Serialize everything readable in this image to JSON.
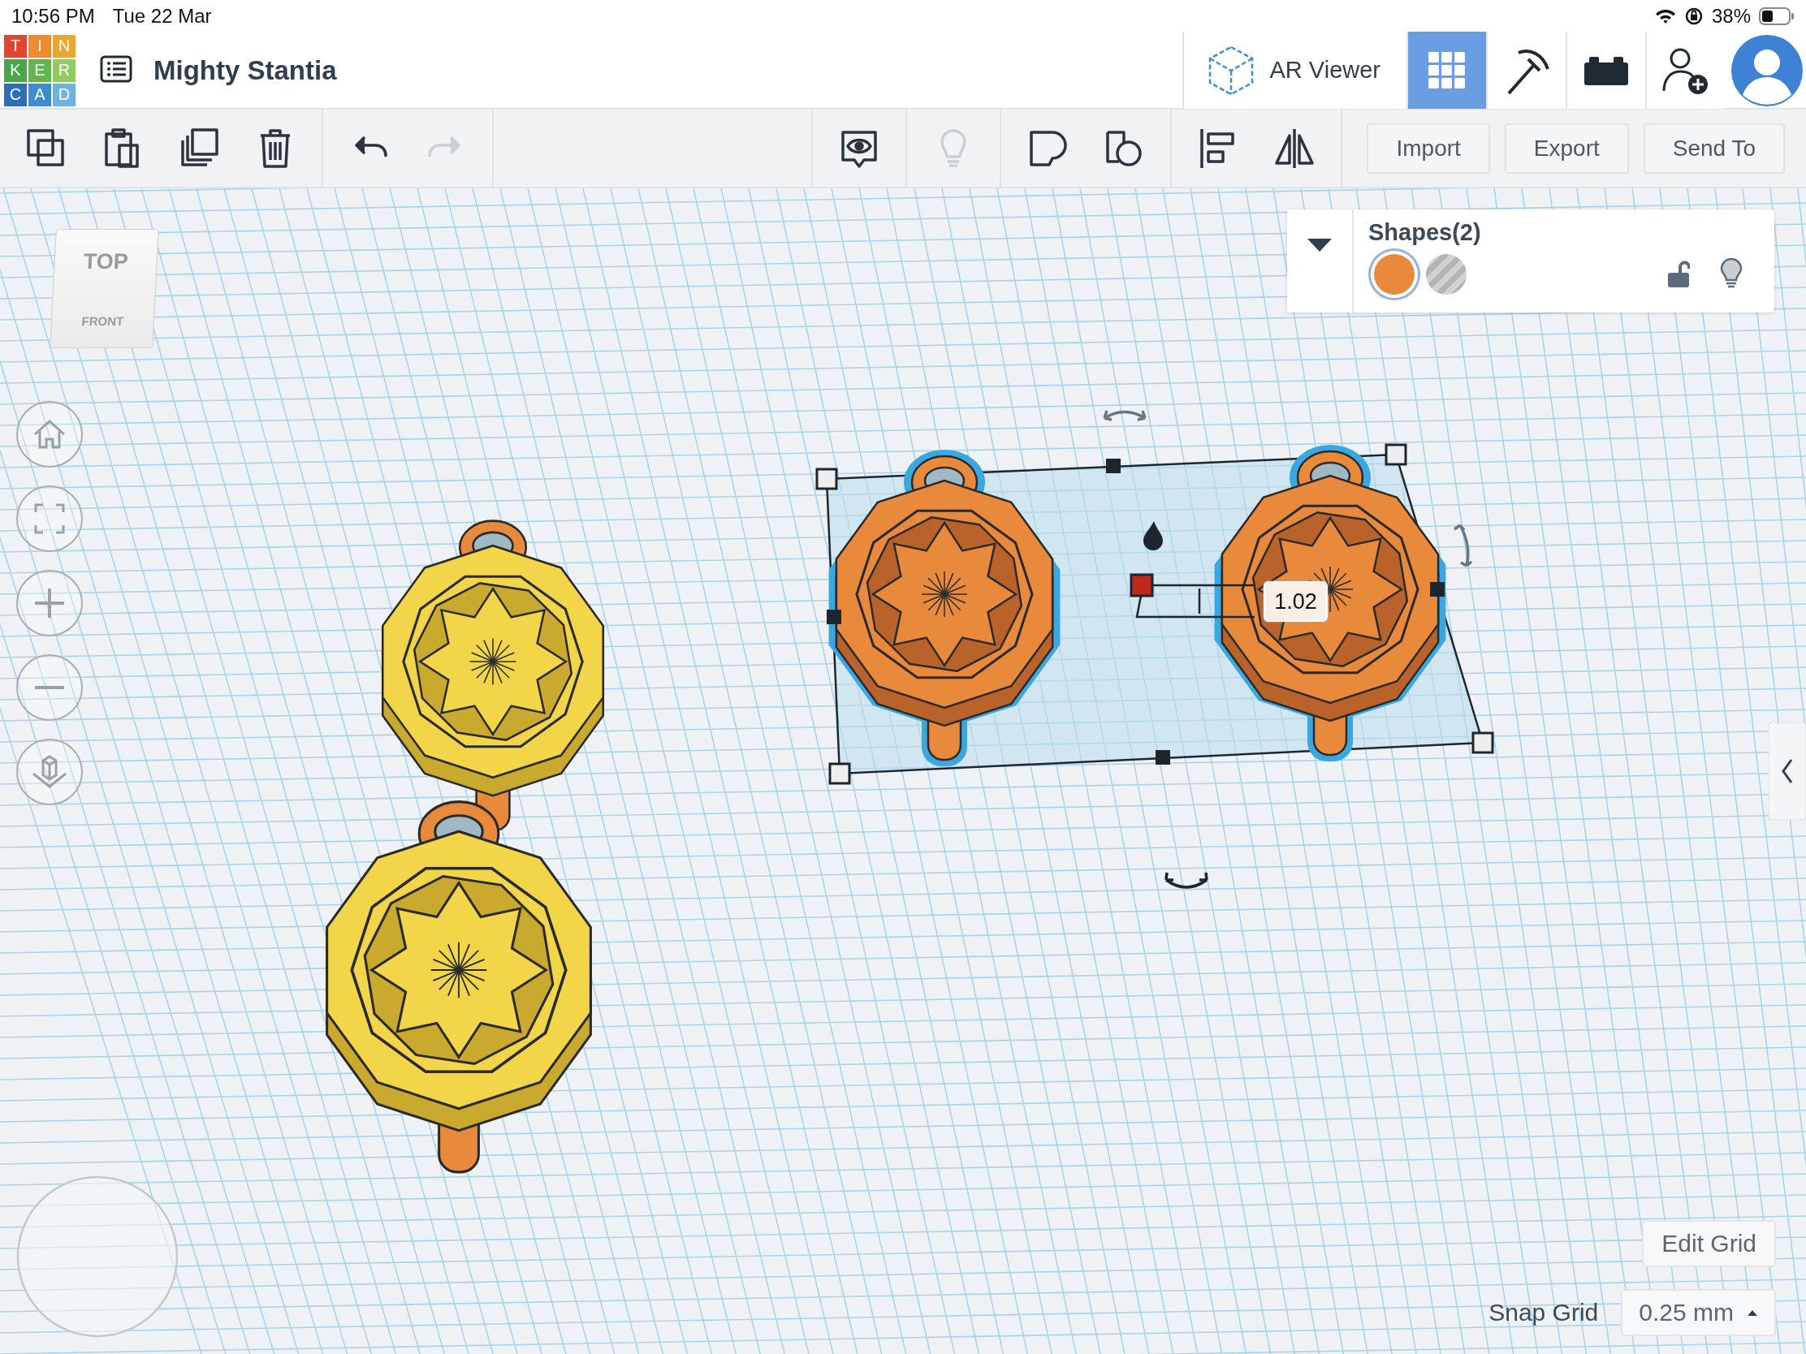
{
  "status_bar": {
    "time": "10:56 PM",
    "date": "Tue 22 Mar",
    "battery": "38%"
  },
  "app_bar": {
    "logo": [
      {
        "letter": "T",
        "color": "#e2452f"
      },
      {
        "letter": "I",
        "color": "#ef8a2d"
      },
      {
        "letter": "N",
        "color": "#eca52f"
      },
      {
        "letter": "K",
        "color": "#4aa54a"
      },
      {
        "letter": "E",
        "color": "#62b54f"
      },
      {
        "letter": "R",
        "color": "#8fcb61"
      },
      {
        "letter": "C",
        "color": "#2a6fb8"
      },
      {
        "letter": "A",
        "color": "#3c8ed0"
      },
      {
        "letter": "D",
        "color": "#6cb2e2"
      }
    ],
    "title": "Mighty Stantia",
    "ar_viewer": "AR Viewer",
    "view_tabs": [
      {
        "kind": "grid",
        "selected": true
      },
      {
        "kind": "pickaxe",
        "selected": false
      },
      {
        "kind": "bricks",
        "selected": false
      }
    ]
  },
  "toolbar": {
    "left_groups": [
      [
        {
          "kind": "copy",
          "disabled": false
        },
        {
          "kind": "paste",
          "disabled": false
        },
        {
          "kind": "duplicate",
          "disabled": false
        },
        {
          "kind": "delete",
          "disabled": false
        }
      ],
      [
        {
          "kind": "undo",
          "disabled": false
        },
        {
          "kind": "redo",
          "disabled": true
        }
      ]
    ],
    "right_groups": [
      [
        {
          "kind": "notes",
          "disabled": false
        }
      ],
      [
        {
          "kind": "light",
          "disabled": true
        }
      ],
      [
        {
          "kind": "solid",
          "disabled": false
        },
        {
          "kind": "hole",
          "disabled": false
        }
      ],
      [
        {
          "kind": "align",
          "disabled": false
        },
        {
          "kind": "mirror",
          "disabled": false
        }
      ]
    ],
    "buttons": [
      "Import",
      "Export",
      "Send To"
    ]
  },
  "view_cube": {
    "top": "TOP",
    "front": "FRONT"
  },
  "shapes_panel": {
    "title": "Shapes(2)",
    "swatches": [
      {
        "kind": "solid",
        "color": "#e8893b",
        "selected": true
      },
      {
        "kind": "hole",
        "selected": false
      }
    ],
    "locked": false
  },
  "dimension": "1.02",
  "edit_grid": "Edit Grid",
  "snap_grid": {
    "label": "Snap Grid",
    "value": "0.25 mm"
  }
}
